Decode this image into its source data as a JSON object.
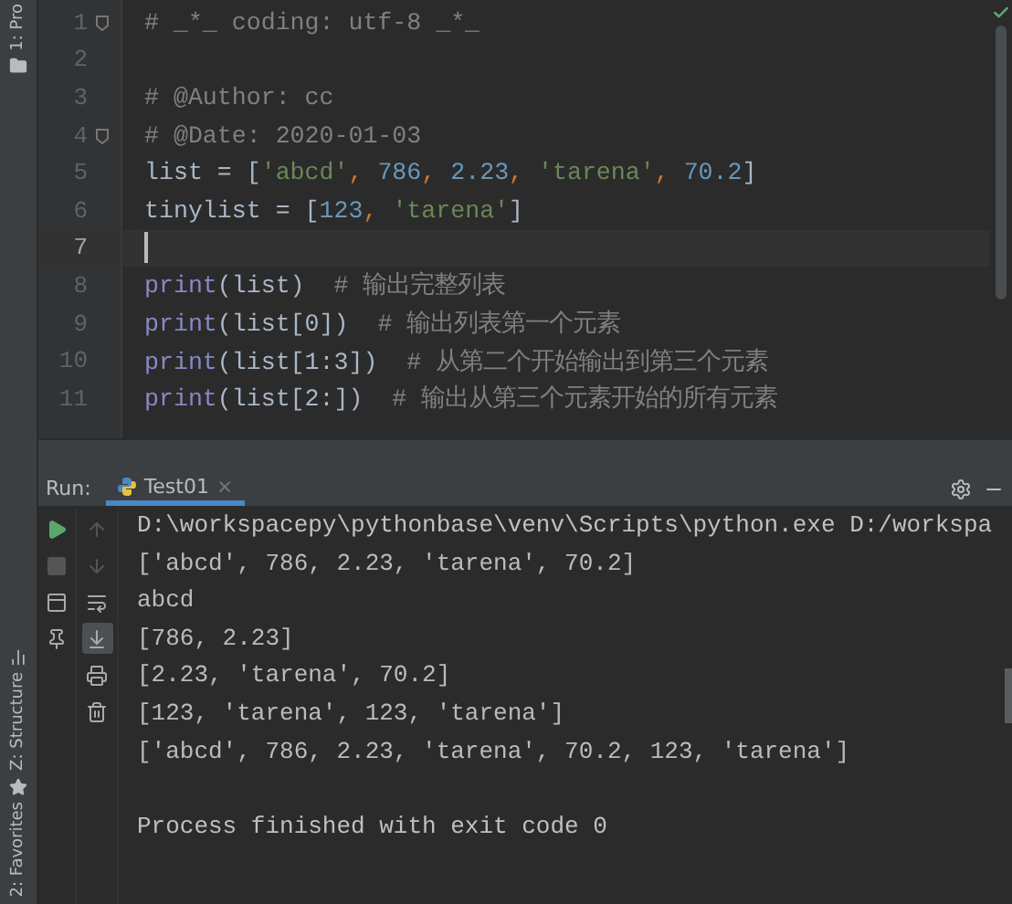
{
  "side_tabs": [
    {
      "label": "1: Pro",
      "kind": "project",
      "selected": false
    },
    {
      "label": "Z: Structure",
      "kind": "structure",
      "selected": false
    },
    {
      "label": "2: Favorites",
      "kind": "favorites",
      "selected": false
    }
  ],
  "editor": {
    "lines": [
      {
        "number": "1",
        "current": false,
        "fold": true,
        "tokens": [
          {
            "kind": "comment",
            "text": "# _*_ coding: utf-8 _*_"
          }
        ]
      },
      {
        "number": "2",
        "current": false,
        "fold": false
      },
      {
        "number": "3",
        "current": false,
        "fold": false,
        "tokens": [
          {
            "kind": "comment",
            "text": "# @Author: cc"
          }
        ]
      },
      {
        "number": "4",
        "current": false,
        "fold": true,
        "tokens": [
          {
            "kind": "comment",
            "text": "# @Date: 2020-01-03"
          }
        ]
      },
      {
        "number": "5",
        "current": false,
        "fold": false,
        "tokens": [
          {
            "kind": "plain",
            "text": "list = ["
          },
          {
            "kind": "string",
            "text": "'abcd'"
          },
          {
            "kind": "keyword",
            "text": ", "
          },
          {
            "kind": "number",
            "text": "786"
          },
          {
            "kind": "keyword",
            "text": ", "
          },
          {
            "kind": "number",
            "text": "2.23"
          },
          {
            "kind": "keyword",
            "text": ", "
          },
          {
            "kind": "string",
            "text": "'tarena'"
          },
          {
            "kind": "keyword",
            "text": ", "
          },
          {
            "kind": "number",
            "text": "70.2"
          },
          {
            "kind": "plain",
            "text": "]"
          }
        ]
      },
      {
        "number": "6",
        "current": false,
        "fold": false,
        "tokens": [
          {
            "kind": "plain",
            "text": "tinylist = ["
          },
          {
            "kind": "number",
            "text": "123"
          },
          {
            "kind": "keyword",
            "text": ", "
          },
          {
            "kind": "string",
            "text": "'tarena'"
          },
          {
            "kind": "plain",
            "text": "]"
          }
        ]
      },
      {
        "number": "7",
        "current": true,
        "fold": false
      },
      {
        "number": "8",
        "current": false,
        "fold": false,
        "tokens": [
          {
            "kind": "builtin",
            "text": "print"
          },
          {
            "kind": "plain",
            "text": "(list)  "
          },
          {
            "kind": "comment",
            "text": "# 输出完整列表"
          }
        ]
      },
      {
        "number": "9",
        "current": false,
        "fold": false,
        "tokens": [
          {
            "kind": "builtin",
            "text": "print"
          },
          {
            "kind": "plain",
            "text": "(list[0])  "
          },
          {
            "kind": "comment",
            "text": "# 输出列表第一个元素"
          }
        ]
      },
      {
        "number": "10",
        "current": false,
        "fold": false,
        "tokens": [
          {
            "kind": "builtin",
            "text": "print"
          },
          {
            "kind": "plain",
            "text": "(list[1:3])  "
          },
          {
            "kind": "comment",
            "text": "# 从第二个开始输出到第三个元素"
          }
        ]
      },
      {
        "number": "11",
        "current": false,
        "fold": false,
        "tokens": [
          {
            "kind": "builtin",
            "text": "print"
          },
          {
            "kind": "plain",
            "text": "(list[2:])  "
          },
          {
            "kind": "comment",
            "text": "# 输出从第三个元素开始的所有元素"
          }
        ]
      }
    ]
  },
  "run_panel": {
    "label": "Run:",
    "tabs": [
      {
        "label": "Test01",
        "selected": true,
        "close": "×"
      }
    ]
  },
  "tools": [
    {
      "column": [
        {
          "kind": "run",
          "disabled": false,
          "on": false
        },
        {
          "kind": "stop",
          "disabled": true,
          "on": false
        },
        {
          "kind": "layout",
          "disabled": false,
          "on": false
        },
        {
          "kind": "pin",
          "disabled": false,
          "on": false
        }
      ]
    },
    {
      "column": [
        {
          "kind": "up",
          "disabled": true,
          "on": false
        },
        {
          "kind": "down",
          "disabled": true,
          "on": false
        },
        {
          "kind": "wrap",
          "disabled": false,
          "on": false
        },
        {
          "kind": "scroll-end",
          "disabled": false,
          "on": true
        },
        {
          "kind": "print",
          "disabled": false,
          "on": false
        },
        {
          "kind": "trash",
          "disabled": false,
          "on": false
        }
      ]
    }
  ],
  "console": [
    {
      "kind": "command",
      "text": "D:\\workspacepy\\pythonbase\\venv\\Scripts\\python.exe D:/workspa"
    },
    {
      "kind": "output",
      "text": "['abcd', 786, 2.23, 'tarena', 70.2]"
    },
    {
      "kind": "output",
      "text": "abcd"
    },
    {
      "kind": "output",
      "text": "[786, 2.23]"
    },
    {
      "kind": "output",
      "text": "[2.23, 'tarena', 70.2]"
    },
    {
      "kind": "output",
      "text": "[123, 'tarena', 123, 'tarena']"
    },
    {
      "kind": "output",
      "text": "['abcd', 786, 2.23, 'tarena', 70.2, 123, 'tarena']"
    },
    {
      "kind": "exit",
      "text": "Process finished with exit code 0"
    }
  ]
}
